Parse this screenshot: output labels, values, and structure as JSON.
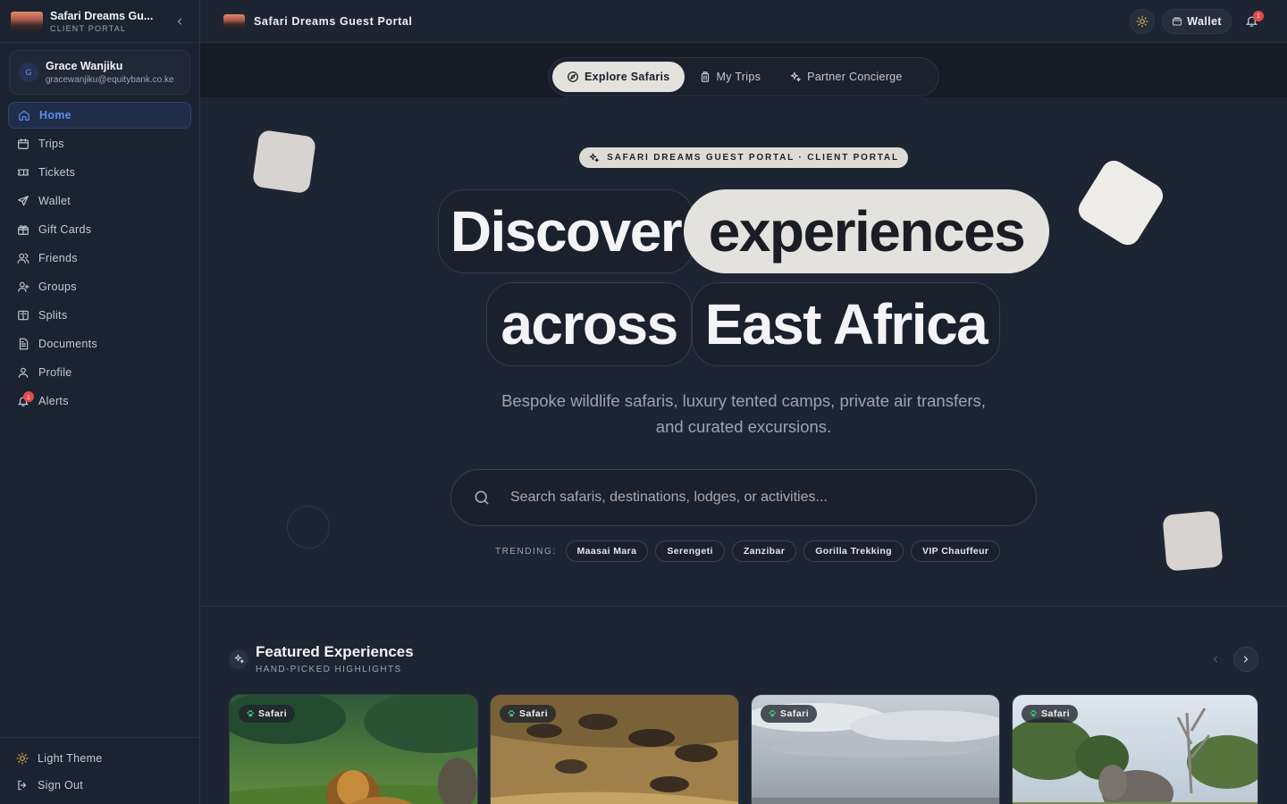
{
  "app": {
    "title": "Safari Dreams Gu...",
    "subtitle": "CLIENT PORTAL",
    "portal_title": "Safari Dreams Guest Portal"
  },
  "user": {
    "initial": "G",
    "name": "Grace Wanjiku",
    "email": "gracewanjiku@equitybank.co.ke"
  },
  "sidebar": {
    "items": [
      {
        "label": "Home",
        "icon": "home-icon",
        "active": true
      },
      {
        "label": "Trips",
        "icon": "calendar-icon"
      },
      {
        "label": "Tickets",
        "icon": "ticket-icon"
      },
      {
        "label": "Wallet",
        "icon": "send-icon"
      },
      {
        "label": "Gift Cards",
        "icon": "gift-icon"
      },
      {
        "label": "Friends",
        "icon": "users-icon"
      },
      {
        "label": "Groups",
        "icon": "user-group-icon"
      },
      {
        "label": "Splits",
        "icon": "split-icon"
      },
      {
        "label": "Documents",
        "icon": "document-icon"
      },
      {
        "label": "Profile",
        "icon": "user-icon"
      },
      {
        "label": "Alerts",
        "icon": "bell-icon",
        "badge": "1"
      }
    ],
    "footer": {
      "theme_label": "Light Theme",
      "signout_label": "Sign Out"
    }
  },
  "topbar": {
    "wallet_label": "Wallet",
    "notification_count": "1"
  },
  "tabs": [
    {
      "label": "Explore Safaris",
      "icon": "compass-icon",
      "active": true
    },
    {
      "label": "My Trips",
      "icon": "luggage-icon"
    },
    {
      "label": "Partner Concierge",
      "icon": "sparkles-icon"
    }
  ],
  "hero": {
    "badge": "SAFARI DREAMS GUEST PORTAL · CLIENT PORTAL",
    "words": [
      "Discover",
      "experiences",
      "across",
      "East Africa"
    ],
    "subtitle_line1": "Bespoke wildlife safaris, luxury tented camps, private air transfers,",
    "subtitle_line2": "and curated excursions.",
    "search_placeholder": "Search safaris, destinations, lodges, or activities...",
    "trending_label": "TRENDING:",
    "trending": [
      "Maasai Mara",
      "Serengeti",
      "Zanzibar",
      "Gorilla Trekking",
      "VIP Chauffeur"
    ]
  },
  "featured": {
    "title": "Featured Experiences",
    "subtitle": "HAND-PICKED HIGHLIGHTS",
    "cards": [
      {
        "tag": "Safari",
        "image": "lion"
      },
      {
        "tag": "Safari",
        "image": "wildebeest"
      },
      {
        "tag": "Safari",
        "image": "sky-plains"
      },
      {
        "tag": "Safari",
        "image": "elephant"
      }
    ]
  },
  "colors": {
    "accent": "#5b8def",
    "badge": "#e5484d",
    "light_pill": "#e4e2df",
    "background": "#1e2532"
  }
}
